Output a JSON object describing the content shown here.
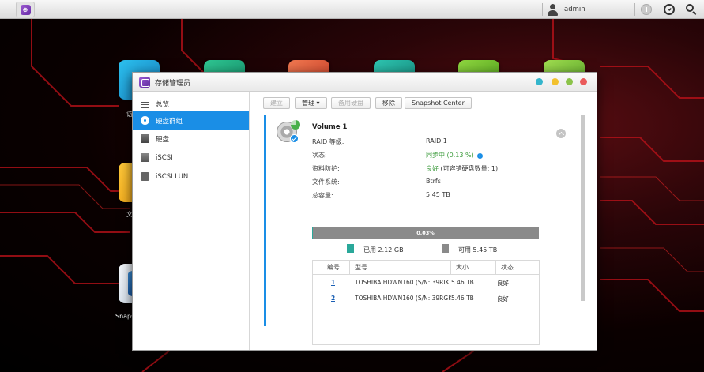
{
  "topbar": {
    "username": "admin"
  },
  "desktop": {
    "apps": [
      {
        "icon": "access-app-icon",
        "label": "访",
        "color": "#1aa3d9"
      },
      {
        "icon": "app-icon-green",
        "label": "",
        "color": "#1fa37a"
      },
      {
        "icon": "app-icon-red",
        "label": "",
        "color": "#e25a3c"
      },
      {
        "icon": "app-icon-teal",
        "label": "",
        "color": "#1aa090"
      },
      {
        "icon": "app-icon-lime",
        "label": "",
        "color": "#6cc027"
      },
      {
        "icon": "app-icon-lime2",
        "label": "",
        "color": "#7fc43a"
      },
      {
        "icon": "file-app-icon",
        "label": "文",
        "color": "#f5b21a"
      },
      {
        "icon": "snapshot-app-icon",
        "label": "Snaps",
        "color": "#e8eef5"
      }
    ]
  },
  "window": {
    "title": "存储管理员",
    "controls": {
      "colors": [
        "#33b5cc",
        "#f2c12e",
        "#8bc34a",
        "#ea5a5a"
      ]
    }
  },
  "sidebar": {
    "items": [
      {
        "label": "总览",
        "icon": "overview-icon"
      },
      {
        "label": "硬盘群组",
        "icon": "disk-group-icon"
      },
      {
        "label": "硬盘",
        "icon": "hdd-icon"
      },
      {
        "label": "iSCSI",
        "icon": "iscsi-icon"
      },
      {
        "label": "iSCSI LUN",
        "icon": "iscsi-lun-icon"
      }
    ],
    "active_index": 1
  },
  "toolbar": {
    "create": "建立",
    "manage": "管理",
    "hot_spare": "备用硬盘",
    "remove": "移除",
    "snapshot_center": "Snapshot Center"
  },
  "volume": {
    "name": "Volume 1",
    "props": [
      {
        "label": "RAID 等级:",
        "value": "RAID 1",
        "green": false
      },
      {
        "label": "状态:",
        "value": "同步中 (0.13 %)",
        "green": true,
        "info": true
      },
      {
        "label": "资料防护:",
        "value_good": "良好",
        "value_rest": " (可容错硬盘数量: 1)",
        "green": true
      },
      {
        "label": "文件系统:",
        "value": "Btrfs",
        "green": false
      },
      {
        "label": "总容量:",
        "value": "5.45 TB",
        "green": false
      }
    ],
    "usage": {
      "percent_text": "0.03%",
      "fraction": 0.0003,
      "used_label": "已用 2.12 GB",
      "free_label": "可用 5.45 TB",
      "used_color": "#2aa89a",
      "free_color": "#8a8a8a"
    },
    "disks": {
      "headers": [
        "编号",
        "型号",
        "大小",
        "状态"
      ],
      "rows": [
        {
          "num": "1",
          "model": "TOSHIBA HDWN160 (S/N: 39RIK...",
          "size": "5.46 TB",
          "status": "良好"
        },
        {
          "num": "2",
          "model": "TOSHIBA HDWN160 (S/N: 39RGK...",
          "size": "5.46 TB",
          "status": "良好"
        }
      ]
    }
  }
}
